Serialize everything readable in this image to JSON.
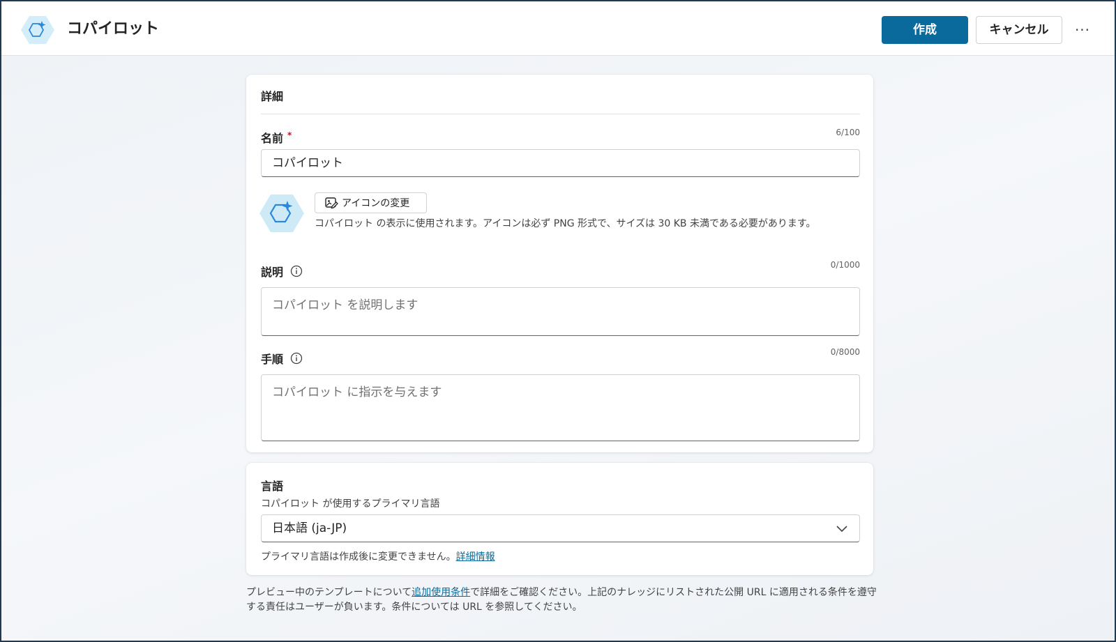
{
  "header": {
    "title": "コパイロット",
    "create_label": "作成",
    "cancel_label": "キャンセル",
    "more_label": "···",
    "icon": "copilot-hexagon-sparkle-icon"
  },
  "details": {
    "section_title": "詳細",
    "name": {
      "label": "名前",
      "required_mark": "*",
      "counter": "6/100",
      "value": "コパイロット"
    },
    "icon": {
      "change_label": "アイコンの変更",
      "help_text": "コパイロット の表示に使用されます。アイコンは必ず PNG 形式で、サイズは 30 KB 未満である必要があります。"
    },
    "description": {
      "label": "説明",
      "counter": "0/1000",
      "placeholder": "コパイロット を説明します"
    },
    "instructions": {
      "label": "手順",
      "counter": "0/8000",
      "placeholder": "コパイロット に指示を与えます"
    }
  },
  "language": {
    "section_title": "言語",
    "subtitle": "コパイロット が使用するプライマリ言語",
    "selected": "日本語 (ja-JP)",
    "note_prefix": "プライマリ言語は作成後に変更できません。",
    "note_link": "詳細情報"
  },
  "footer": {
    "text_before": "プレビュー中のテンプレートについて",
    "link": "追加使用条件",
    "text_after": "で詳細をご確認ください。上記のナレッジにリストされた公開 URL に適用される条件を遵守する責任はユーザーが負います。条件については URL を参照してください。"
  },
  "colors": {
    "primary": "#0b6a9c",
    "required": "#c50f1f",
    "icon_bg": "#cfeaf7",
    "icon_accent": "#2b88d8"
  }
}
